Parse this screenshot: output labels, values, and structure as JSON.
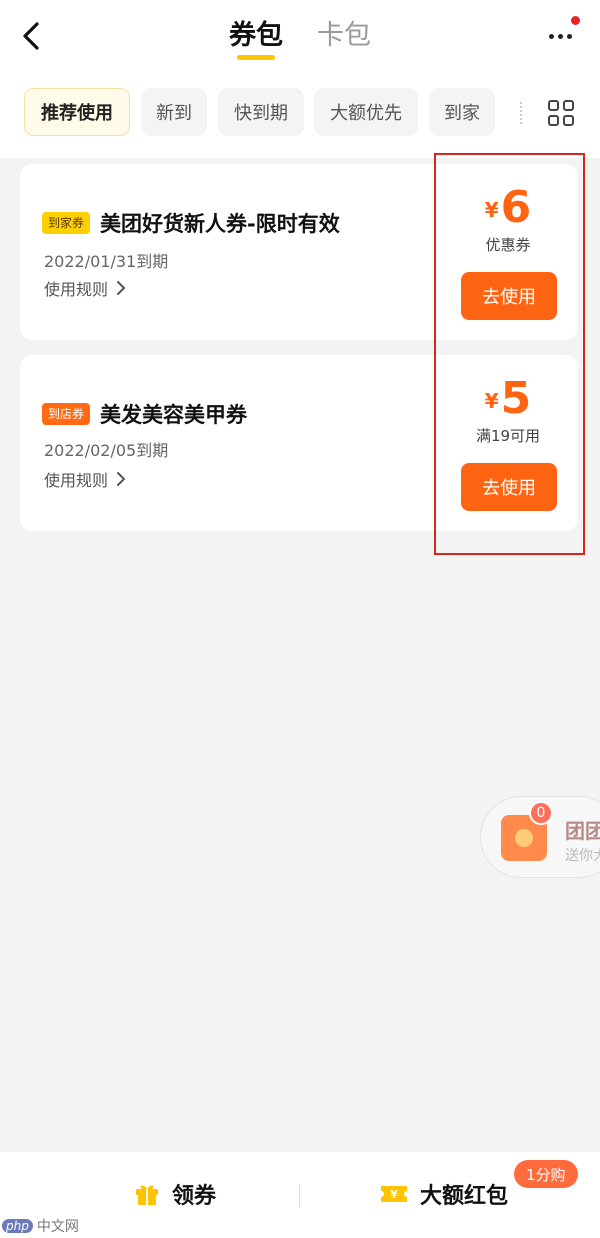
{
  "header": {
    "tabs": [
      {
        "label": "券包",
        "active": true
      },
      {
        "label": "卡包",
        "active": false
      }
    ],
    "icons": {
      "back": "chevron-left-icon",
      "more": "more-dots-icon"
    },
    "notification_dot_color": "#e8262a"
  },
  "filters": {
    "chips": [
      "推荐使用",
      "新到",
      "快到期",
      "大额优先",
      "到家"
    ],
    "selected": "推荐使用"
  },
  "coupons": [
    {
      "tag": "到家券",
      "title": "美团好货新人券-限时有效",
      "expire": "2022/01/31到期",
      "rules": "使用规则",
      "currency": "¥",
      "amount": "6",
      "desc": "优惠券",
      "button": "去使用"
    },
    {
      "tag": "到店券",
      "title": "美发美容美甲券",
      "expire": "2022/02/05到期",
      "rules": "使用规则",
      "currency": "¥",
      "amount": "5",
      "desc": "满19可用",
      "button": "去使用"
    }
  ],
  "float_widget": {
    "badge": "0",
    "title": "团团",
    "subtitle": "送你大"
  },
  "bottom_bar": {
    "left_label": "领券",
    "right_label": "大额红包",
    "badge": "1分购"
  },
  "watermark": {
    "brand": "php",
    "text": "中文网"
  },
  "colors": {
    "accent": "#ff6412",
    "tab_underline": "#ffc300",
    "highlight": "#d9261c"
  }
}
